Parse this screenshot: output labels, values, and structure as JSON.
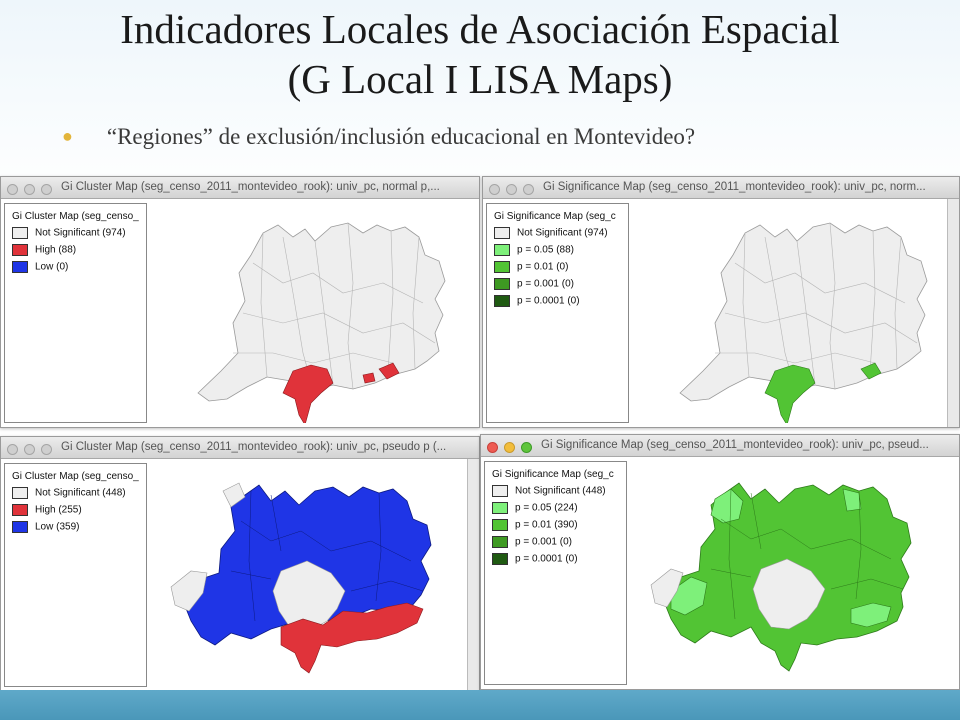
{
  "slide": {
    "title_line1": "Indicadores Locales de Asociación Espacial",
    "title_line2": "(G Local I LISA Maps)",
    "bullet": "“Regiones” de exclusión/inclusión educacional en Montevideo?"
  },
  "windows": [
    {
      "title": "Gi Cluster Map (seg_censo_2011_montevideo_rook): univ_pc, normal p,...",
      "legend_title": "Gi Cluster Map (seg_censo_",
      "active": false,
      "items": [
        {
          "label": "Not Significant (974)",
          "color": "#eeeeee"
        },
        {
          "label": "High (88)",
          "color": "#e0333a"
        },
        {
          "label": "Low (0)",
          "color": "#1f35e6"
        }
      ]
    },
    {
      "title": "Gi Significance Map (seg_censo_2011_montevideo_rook): univ_pc, norm...",
      "legend_title": "Gi Significance Map (seg_c",
      "active": false,
      "items": [
        {
          "label": "Not Significant (974)",
          "color": "#eeeeee"
        },
        {
          "label": "p = 0.05 (88)",
          "color": "#7ef07a"
        },
        {
          "label": "p = 0.01 (0)",
          "color": "#52c434"
        },
        {
          "label": "p = 0.001 (0)",
          "color": "#3e9a22"
        },
        {
          "label": "p = 0.0001 (0)",
          "color": "#1f5a12"
        }
      ]
    },
    {
      "title": "Gi Cluster Map (seg_censo_2011_montevideo_rook): univ_pc, pseudo p (...",
      "legend_title": "Gi Cluster Map (seg_censo_",
      "active": false,
      "items": [
        {
          "label": "Not Significant (448)",
          "color": "#eeeeee"
        },
        {
          "label": "High (255)",
          "color": "#e0333a"
        },
        {
          "label": "Low (359)",
          "color": "#1f35e6"
        }
      ]
    },
    {
      "title": "Gi Significance Map (seg_censo_2011_montevideo_rook): univ_pc, pseud...",
      "legend_title": "Gi Significance Map (seg_c",
      "active": true,
      "items": [
        {
          "label": "Not Significant (448)",
          "color": "#eeeeee"
        },
        {
          "label": "p = 0.05 (224)",
          "color": "#7ef07a"
        },
        {
          "label": "p = 0.01 (390)",
          "color": "#52c434"
        },
        {
          "label": "p = 0.001 (0)",
          "color": "#3e9a22"
        },
        {
          "label": "p = 0.0001 (0)",
          "color": "#1f5a12"
        }
      ]
    }
  ],
  "icons": {
    "bullet": "bullet-dot-icon",
    "window_controls": [
      "close-button-icon",
      "minimize-button-icon",
      "zoom-button-icon"
    ]
  },
  "colors": {
    "bullet": "#e3b53b",
    "footer_bar": "#4a97b9",
    "map_not_significant": "#eeeeee",
    "map_outline": "#9a9a9a"
  }
}
